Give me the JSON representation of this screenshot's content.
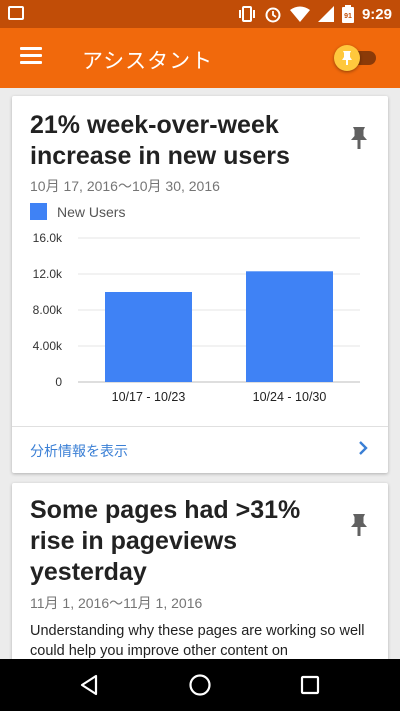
{
  "status_bar": {
    "time": "9:29",
    "icons": [
      "image-notification-icon",
      "vibrate-icon",
      "alarm-icon",
      "wifi-icon",
      "signal-icon",
      "battery-icon"
    ],
    "battery_text": "91"
  },
  "app_bar": {
    "title": "アシスタント",
    "menu_icon": "hamburger-menu-icon",
    "toggle_icon": "pin-toggle-icon",
    "colors": {
      "status": "#c14d07",
      "bar": "#f1690c",
      "thumb": "#ffc83d"
    }
  },
  "cards": [
    {
      "title": "21% week-over-week increase in new users",
      "date_range": "10月 17, 2016～10月 30, 2016",
      "pin_icon": "pin-icon",
      "legend_label": "New Users",
      "footer_link": "分析情報を表示",
      "footer_icon": "chevron-right-icon"
    },
    {
      "title": "Some pages had >31% rise in pageviews yesterday",
      "date_range": "11月 1, 2016～11月 1, 2016",
      "pin_icon": "pin-icon",
      "description": "Understanding why these pages are working so well could help you improve other content on"
    }
  ],
  "chart_data": {
    "type": "bar",
    "categories": [
      "10/17 - 10/23",
      "10/24 - 10/30"
    ],
    "series": [
      {
        "name": "New Users",
        "values": [
          10000,
          12300
        ]
      }
    ],
    "y_ticks": [
      "0",
      "4.00k",
      "8.00k",
      "12.0k",
      "16.0k"
    ],
    "ylim": [
      0,
      16000
    ],
    "grid": true,
    "color": "#3f82f5"
  },
  "nav_bar": {
    "buttons": [
      "back-icon",
      "home-icon",
      "recents-icon"
    ]
  }
}
